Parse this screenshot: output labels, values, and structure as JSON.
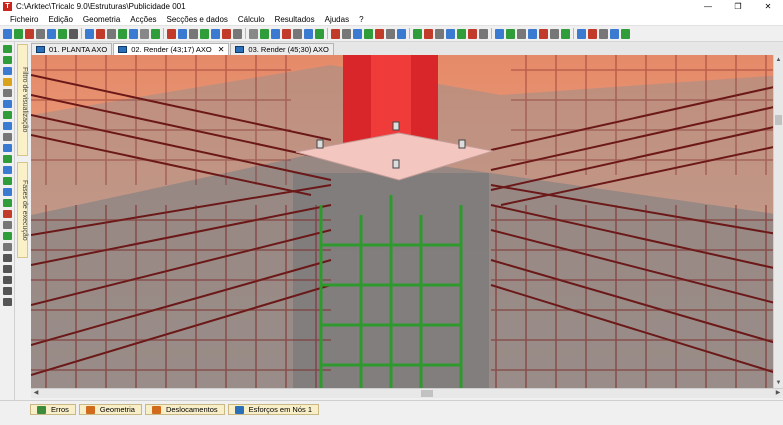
{
  "window": {
    "title": "C:\\Arktec\\Tricalc 9.0\\Estruturas\\Publicidade 001",
    "app_icon_letter": "T",
    "controls": {
      "minimize": "—",
      "restore": "❐",
      "close": "✕"
    }
  },
  "menu": [
    {
      "id": "ficheiro",
      "label": "Ficheiro"
    },
    {
      "id": "edicao",
      "label": "Edição"
    },
    {
      "id": "geometria",
      "label": "Geometria"
    },
    {
      "id": "accoes",
      "label": "Acções"
    },
    {
      "id": "seccoes",
      "label": "Secções e dados"
    },
    {
      "id": "calculo",
      "label": "Cálculo"
    },
    {
      "id": "resultados",
      "label": "Resultados"
    },
    {
      "id": "ajudas",
      "label": "Ajudas"
    },
    {
      "id": "help",
      "label": "?"
    }
  ],
  "toolbar": {
    "colors": [
      "#3b7ad1",
      "#2f9e3a",
      "#c23a2a",
      "#777",
      "#3b7ad1",
      "#2f9e3a",
      "#5a5a5a",
      "#3b7ad1",
      "#c23a2a",
      "#777",
      "#2f9e3a",
      "#3b7ad1",
      "#888",
      "#2f9e3a",
      "#c23a2a",
      "#3b7ad1",
      "#777",
      "#2f9e3a",
      "#3b7ad1",
      "#c23a2a",
      "#777",
      "#888",
      "#2f9e3a",
      "#3b7ad1",
      "#c23a2a",
      "#777",
      "#3b7ad1",
      "#2f9e3a",
      "#c23a2a",
      "#777",
      "#3b7ad1",
      "#2f9e3a",
      "#c23a2a",
      "#777",
      "#3b7ad1",
      "#2f9e3a",
      "#c23a2a",
      "#777",
      "#3b7ad1",
      "#2f9e3a",
      "#c23a2a",
      "#777",
      "#3b7ad1",
      "#2f9e3a",
      "#777",
      "#3b7ad1",
      "#c23a2a",
      "#777",
      "#2f9e3a",
      "#3b7ad1",
      "#c23a2a",
      "#777",
      "#3b7ad1",
      "#2f9e3a"
    ]
  },
  "tabs": [
    {
      "label": "01. PLANTA   AXO"
    },
    {
      "label": "02. Render (43;17)  AXO"
    },
    {
      "label": "03. Render (45;30)  AXO"
    }
  ],
  "active_tab_close": "✕",
  "side_panels": [
    {
      "label": "Filtro de visualização"
    },
    {
      "label": "Fases de execução"
    }
  ],
  "scrollbars": {
    "up": "▲",
    "down": "▼",
    "left": "◀",
    "right": "▶"
  },
  "bottom_tabs": [
    {
      "label": "Erros",
      "icon": "errors-icon",
      "color": "#3a8c3a"
    },
    {
      "label": "Geometria",
      "icon": "geometry-icon",
      "color": "#d26a1e"
    },
    {
      "label": "Deslocamentos",
      "icon": "displacements-icon",
      "color": "#d26a1e"
    },
    {
      "label": "Esforços em Nós 1",
      "icon": "forces-icon",
      "color": "#2a6fb8"
    }
  ]
}
